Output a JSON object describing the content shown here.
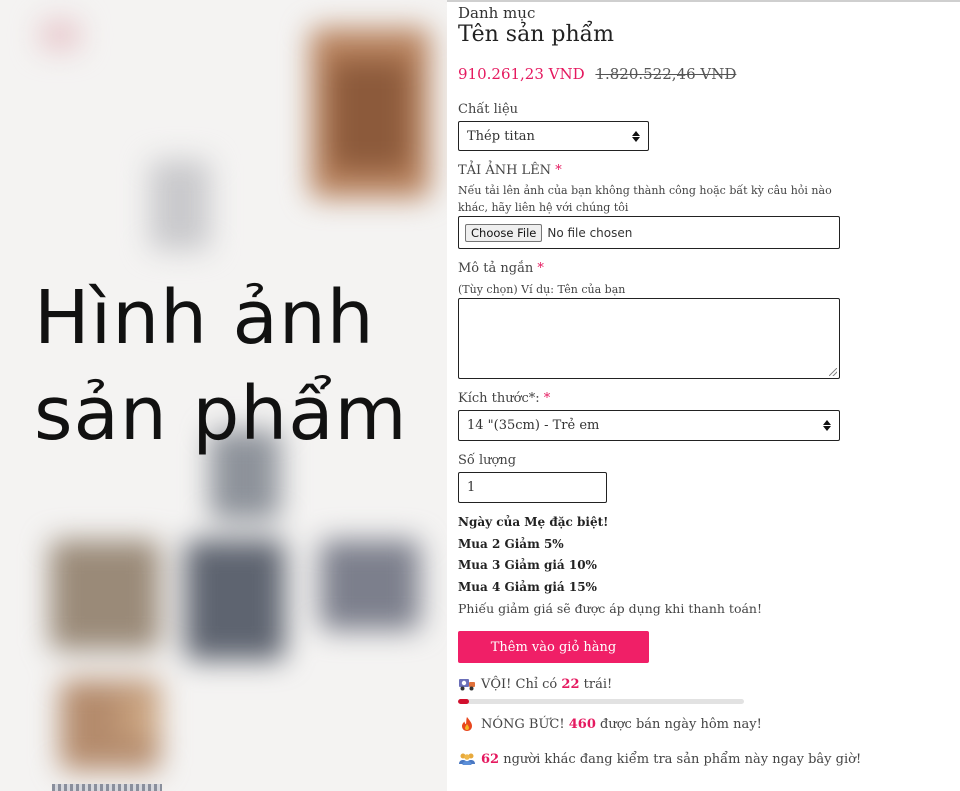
{
  "gallery": {
    "caption_line1": "Hình ảnh",
    "caption_line2": "sản phẩm"
  },
  "product": {
    "category": "Danh mục",
    "title": "Tên sản phẩm",
    "price_now": "910.261,23 VND",
    "price_old": "1.820.522,46 VND"
  },
  "material": {
    "label": "Chất liệu",
    "selected": "Thép titan"
  },
  "upload": {
    "label": "TẢI ẢNH LÊN",
    "required_mark": "*",
    "help": "Nếu tải lên ảnh của bạn không thành công hoặc bất kỳ câu hỏi nào khác, hãy liên hệ với chúng tôi",
    "button_label": "Choose File",
    "status": "No file chosen"
  },
  "description": {
    "label": "Mô tả ngắn",
    "required_mark": "*",
    "help": "(Tùy chọn) Ví dụ: Tên của bạn",
    "value": ""
  },
  "size": {
    "label": "Kích thước*:",
    "required_mark": "*",
    "selected": "14 \"(35cm) - Trẻ em"
  },
  "quantity": {
    "label": "Số lượng",
    "value": "1"
  },
  "promo": {
    "headline": "Ngày của Mẹ đặc biệt!",
    "line1": "Mua 2 Giảm 5%",
    "line2": "Mua 3 Giảm giá 10%",
    "line3": "Mua 4 Giảm giá 15%",
    "note": "Phiếu giảm giá sẽ được áp dụng khi thanh toán!"
  },
  "cart": {
    "button_label": "Thêm vào giỏ hàng"
  },
  "stock": {
    "prefix": "VỘI! Chỉ có",
    "count": "22",
    "suffix": "trái!",
    "progress": 0.04
  },
  "sold": {
    "prefix": "NÓNG BỨC!",
    "count": "460",
    "suffix": "được bán ngày hôm nay!"
  },
  "viewers": {
    "count": "62",
    "suffix": "người khác đang kiểm tra sản phẩm này ngay bây giờ!"
  },
  "colors": {
    "accent": "#e5195f",
    "button": "#f01f67",
    "progress": "#d10f2e"
  },
  "icons": {
    "stock": "truck-icon",
    "sold": "fire-icon",
    "viewers": "people-icon"
  }
}
